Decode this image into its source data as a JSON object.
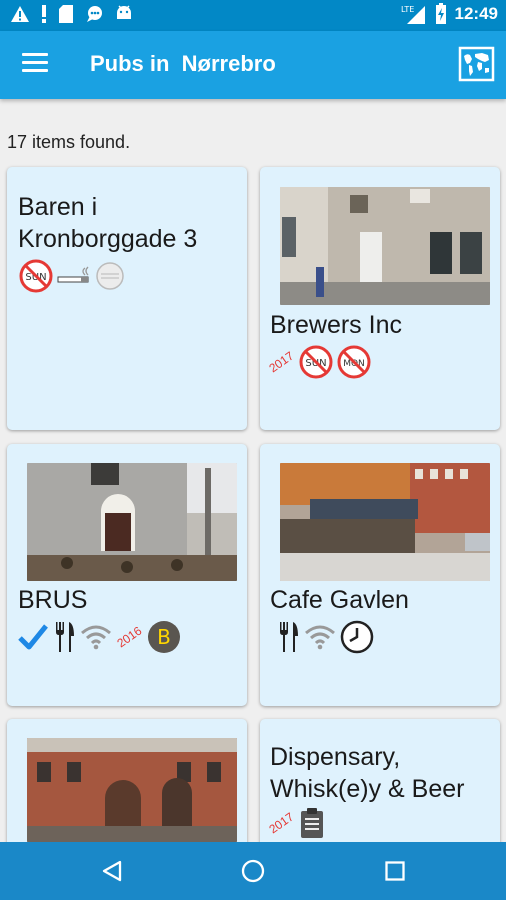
{
  "status": {
    "time": "12:49",
    "icons": [
      "warning-icon",
      "alert-icon",
      "sdcard-icon",
      "chat-icon",
      "android-icon",
      "signal-icon",
      "battery-icon"
    ]
  },
  "appbar": {
    "title": "Pubs in  Nørrebro",
    "menu_icon": "hamburger-icon",
    "map_icon": "world-map-icon"
  },
  "list": {
    "count_text": "17 items found."
  },
  "cards": [
    {
      "name": "Baren i Kronborggade 3",
      "icons": [
        "no-sunday-icon",
        "smoking-icon",
        "coin-icon"
      ]
    },
    {
      "name": "Brewers Inc",
      "year": "2017",
      "icons": [
        "no-sunday-icon",
        "no-monday-icon"
      ]
    },
    {
      "name": "BRUS",
      "year": "2016",
      "badge": "B",
      "icons": [
        "check-icon",
        "cutlery-icon",
        "wifi-icon"
      ]
    },
    {
      "name": "Cafe Gavlen",
      "icons": [
        "cutlery-icon",
        "wifi-icon",
        "clock-icon"
      ]
    },
    {
      "name": "",
      "icons": []
    },
    {
      "name": "Dispensary, Whisk(e)y & Beer",
      "year": "2017",
      "icons": [
        "clipboard-icon"
      ]
    }
  ],
  "icon_labels": {
    "sun": "SUN",
    "mon": "MON"
  },
  "colors": {
    "primary": "#1aa1e2",
    "status": "#0288c6",
    "card": "#dff2fd",
    "no_sign": "#e53935"
  }
}
